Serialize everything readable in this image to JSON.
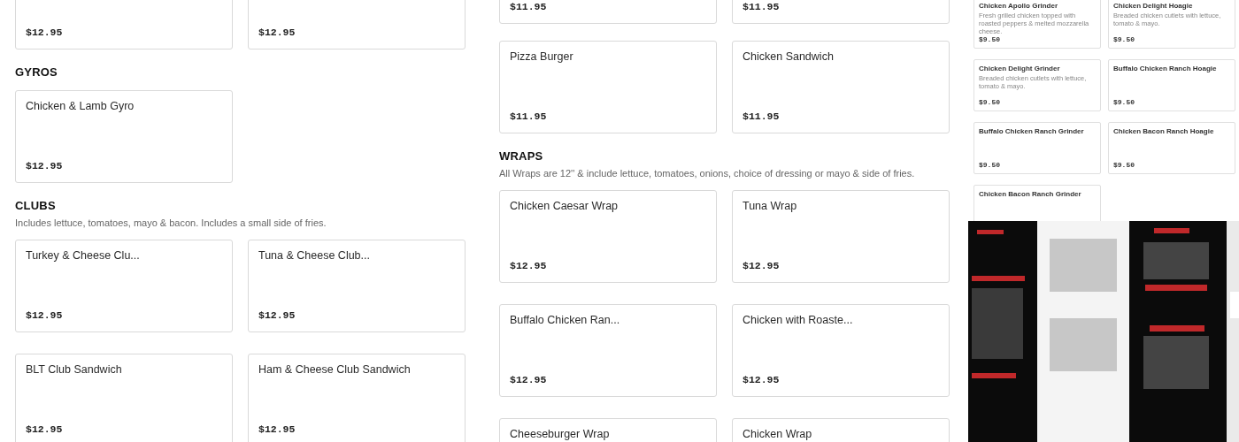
{
  "menu_left": [
    {
      "items": [
        {
          "price": "$12.95"
        },
        {
          "price": "$12.95"
        }
      ]
    },
    {
      "heading": "GYROS",
      "items": [
        {
          "name": "Chicken & Lamb Gyro",
          "price": "$12.95"
        }
      ]
    },
    {
      "heading": "CLUBS",
      "description": "Includes lettuce, tomatoes, mayo & bacon. Includes a small side of fries.",
      "items": [
        {
          "name": "Turkey & Cheese Clu...",
          "price": "$12.95"
        },
        {
          "name": "Tuna & Cheese Club...",
          "price": "$12.95"
        },
        {
          "name": "BLT Club Sandwich",
          "price": "$12.95"
        },
        {
          "name": "Ham & Cheese Club Sandwich",
          "price": "$12.95"
        }
      ]
    }
  ],
  "menu_middle": [
    {
      "items": [
        {
          "price": "$11.95"
        },
        {
          "price": "$11.95"
        },
        {
          "name": "Pizza Burger",
          "price": "$11.95"
        },
        {
          "name": "Chicken Sandwich",
          "price": "$11.95"
        }
      ]
    },
    {
      "heading": "WRAPS",
      "description": "All Wraps are 12'' & include lettuce, tomatoes, onions, choice of dressing or mayo & side of fries.",
      "items": [
        {
          "name": "Chicken Caesar Wrap",
          "price": "$12.95"
        },
        {
          "name": "Tuna Wrap",
          "price": "$12.95"
        },
        {
          "name": "Buffalo Chicken Ran...",
          "price": "$12.95"
        },
        {
          "name": "Chicken with Roaste...",
          "price": "$12.95"
        },
        {
          "name": "Cheeseburger Wrap"
        },
        {
          "name": "Chicken Wrap"
        }
      ]
    }
  ],
  "preview_panel": {
    "items": [
      {
        "name": "Chicken Apollo Grinder",
        "description": "Fresh grilled chicken topped with roasted peppers & melted mozzarella cheese.",
        "price": "$9.50"
      },
      {
        "name": "Chicken Delight Hoagie",
        "description": "Breaded chicken cutlets with lettuce, tomato & mayo.",
        "price": "$9.50"
      },
      {
        "name": "Chicken Delight Grinder",
        "description": "Breaded chicken cutlets with lettuce, tomato & mayo.",
        "price": "$9.50"
      },
      {
        "name": "Buffalo Chicken Ranch Hoagie",
        "price": "$9.50"
      },
      {
        "name": "Buffalo Chicken Ranch Grinder",
        "price": "$9.50"
      },
      {
        "name": "Chicken Bacon Ranch Hoagie",
        "price": "$9.50"
      },
      {
        "name": "Chicken Bacon Ranch Grinder"
      }
    ]
  }
}
